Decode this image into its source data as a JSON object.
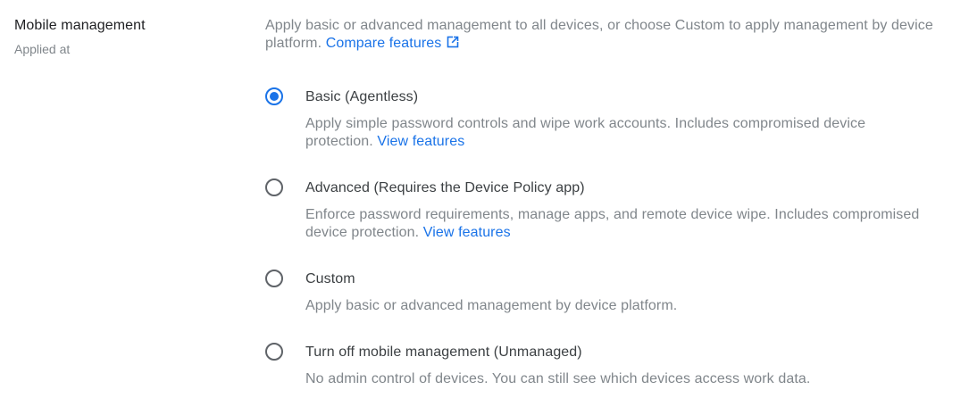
{
  "setting": {
    "title": "Mobile management",
    "applied_at_label": "Applied at"
  },
  "intro": {
    "text": "Apply basic or advanced management to all devices, or choose Custom to apply management by device platform.",
    "link_label": "Compare features",
    "link_icon": "open-in-new-icon"
  },
  "options": [
    {
      "label": "Basic (Agentless)",
      "description": "Apply simple password controls and wipe work accounts. Includes compromised device protection.",
      "link_label": "View features",
      "selected": true
    },
    {
      "label": "Advanced (Requires the Device Policy app)",
      "description": "Enforce password requirements, manage apps, and remote device wipe. Includes compromised device protection.",
      "link_label": "View features",
      "selected": false
    },
    {
      "label": "Custom",
      "description": "Apply basic or advanced management by device platform.",
      "selected": false
    },
    {
      "label": "Turn off mobile management (Unmanaged)",
      "description": "No admin control of devices. You can still see which devices access work data.",
      "selected": false
    }
  ],
  "colors": {
    "accent": "#1a73e8",
    "secondary_text": "#80868b",
    "primary_text": "#202124"
  }
}
